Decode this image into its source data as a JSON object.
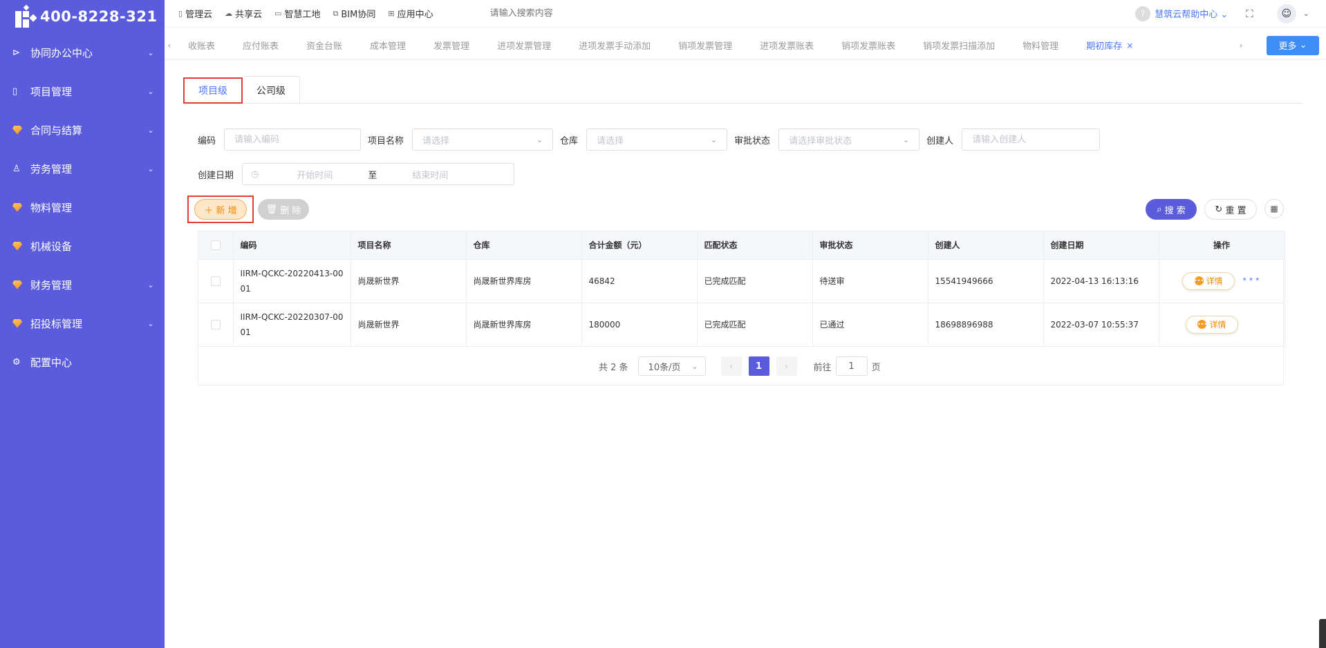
{
  "sidebar": {
    "phone": "400-8228-321",
    "items": [
      {
        "label": "协同办公中心",
        "icon": "send-icon",
        "glyph": "⊳",
        "has_children": true
      },
      {
        "label": "项目管理",
        "icon": "book-icon",
        "glyph": "▯",
        "has_children": true
      },
      {
        "label": "合同与结算",
        "icon": "gem-icon",
        "has_children": true
      },
      {
        "label": "劳务管理",
        "icon": "worker-icon",
        "glyph": "♙",
        "has_children": true
      },
      {
        "label": "物料管理",
        "icon": "gem-icon",
        "has_children": false
      },
      {
        "label": "机械设备",
        "icon": "gem-icon",
        "has_children": false
      },
      {
        "label": "财务管理",
        "icon": "gem-icon",
        "has_children": true
      },
      {
        "label": "招投标管理",
        "icon": "gem-icon",
        "has_children": true
      },
      {
        "label": "配置中心",
        "icon": "gear-icon",
        "glyph": "⚙",
        "has_children": false
      }
    ]
  },
  "topbar": {
    "links": [
      {
        "label": "管理云",
        "icon": "doc-icon"
      },
      {
        "label": "共享云",
        "icon": "cloud-icon"
      },
      {
        "label": "智慧工地",
        "icon": "monitor-icon"
      },
      {
        "label": "BIM协同",
        "icon": "box-icon"
      },
      {
        "label": "应用中心",
        "icon": "grid-icon"
      }
    ],
    "search_placeholder": "请输入搜索内容",
    "help_label": "慧筑云帮助中心"
  },
  "tabstrip": {
    "tabs": [
      "收账表",
      "应付账表",
      "资金台账",
      "成本管理",
      "发票管理",
      "进项发票管理",
      "进项发票手动添加",
      "销项发票管理",
      "进项发票账表",
      "销项发票账表",
      "销项发票扫描添加",
      "物料管理"
    ],
    "active_tab": "期初库存",
    "more_label": "更多"
  },
  "level_tabs": {
    "project": "项目级",
    "company": "公司级"
  },
  "filters": {
    "code_label": "编码",
    "code_placeholder": "请输入编码",
    "project_label": "项目名称",
    "project_placeholder": "请选择",
    "warehouse_label": "仓库",
    "warehouse_placeholder": "请选择",
    "approval_label": "审批状态",
    "approval_placeholder": "请选择审批状态",
    "creator_label": "创建人",
    "creator_placeholder": "请输入创建人",
    "date_label": "创建日期",
    "start_placeholder": "开始时间",
    "range_sep": "至",
    "end_placeholder": "结束时间"
  },
  "actions": {
    "add": "新 增",
    "delete": "删 除",
    "search": "搜 索",
    "reset": "重 置"
  },
  "table": {
    "columns": [
      "编码",
      "项目名称",
      "仓库",
      "合计金额（元）",
      "匹配状态",
      "审批状态",
      "创建人",
      "创建日期",
      "操作"
    ],
    "rows": [
      {
        "code": "IIRM-QCKC-20220413-0001",
        "project": "尚晟新世界",
        "warehouse": "尚晟新世界库房",
        "amount": "46842",
        "match": "已完成匹配",
        "approval": "待送审",
        "creator": "15541949666",
        "date": "2022-04-13 16:13:16",
        "op": "详情",
        "has_more": true
      },
      {
        "code": "IIRM-QCKC-20220307-0001",
        "project": "尚晟新世界",
        "warehouse": "尚晟新世界库房",
        "amount": "180000",
        "match": "已完成匹配",
        "approval": "已通过",
        "creator": "18698896988",
        "date": "2022-03-07 10:55:37",
        "op": "详情",
        "has_more": false
      }
    ]
  },
  "pager": {
    "total": "共 2 条",
    "page_size": "10条/页",
    "current": "1",
    "goto_label": "前往",
    "goto_value": "1",
    "page_suffix": "页"
  },
  "colors": {
    "sidebar_bg": "#5a5cdb",
    "accent_blue": "#4a76ff",
    "add_orange": "#f08a00",
    "highlight_red": "#e53935"
  }
}
